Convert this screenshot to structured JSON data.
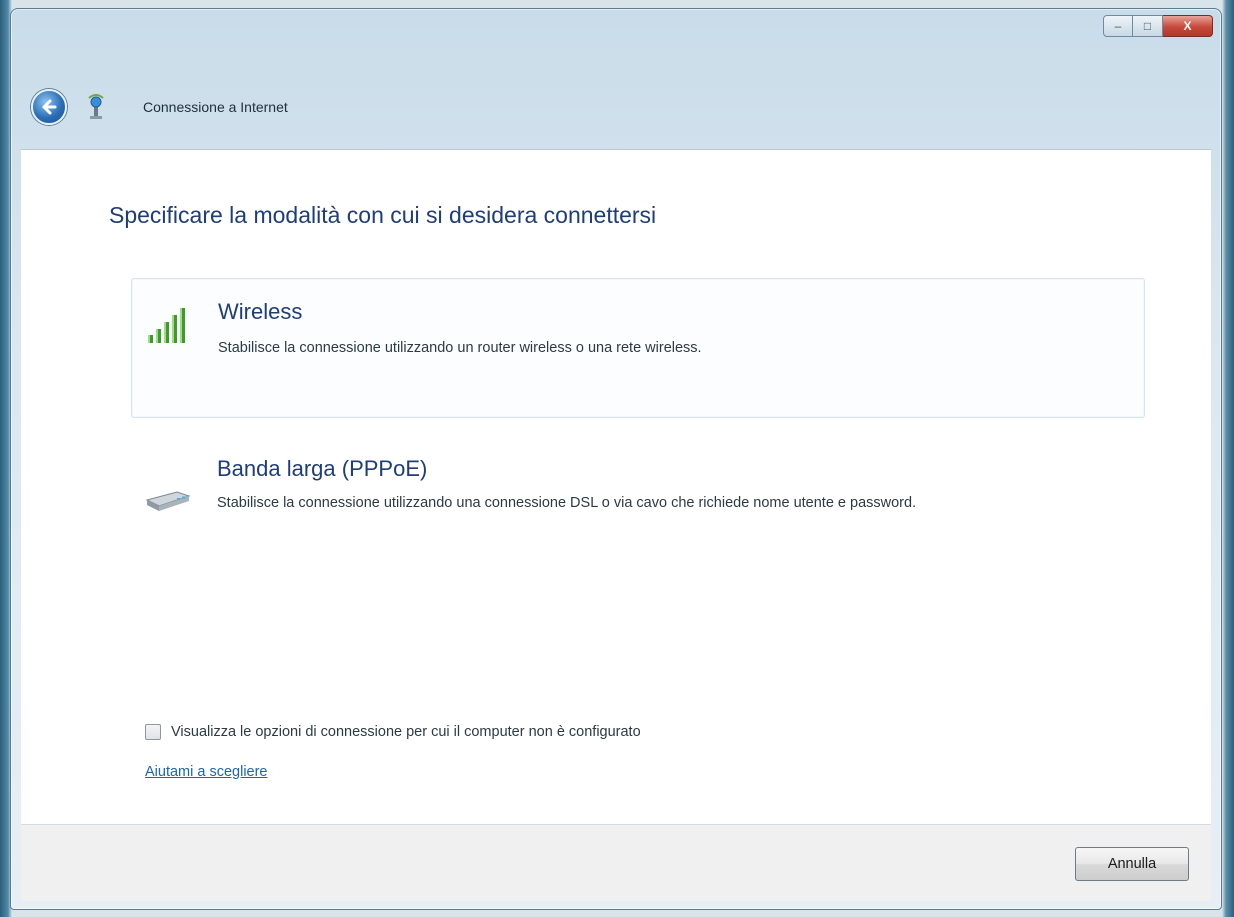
{
  "window": {
    "title": "Connessione a Internet",
    "caption_buttons": {
      "minimize": "–",
      "maximize": "□",
      "close": "X"
    }
  },
  "heading": "Specificare la modalità con cui si desidera connettersi",
  "options": [
    {
      "title": "Wireless",
      "description": "Stabilisce la connessione utilizzando un router wireless o una rete wireless.",
      "icon": "wireless-signal-icon",
      "selected": true
    },
    {
      "title": "Banda larga (PPPoE)",
      "description": "Stabilisce la connessione utilizzando una connessione DSL o via cavo che richiede nome utente e password.",
      "icon": "broadband-modem-icon",
      "selected": false
    }
  ],
  "checkbox": {
    "label": "Visualizza le opzioni di connessione per cui il computer non è configurato",
    "checked": false
  },
  "help_link": "Aiutami a scegliere",
  "footer": {
    "cancel_label": "Annulla"
  },
  "colors": {
    "heading": "#1f3d76",
    "link": "#1c64b4",
    "signal": "#3e9a2c"
  }
}
